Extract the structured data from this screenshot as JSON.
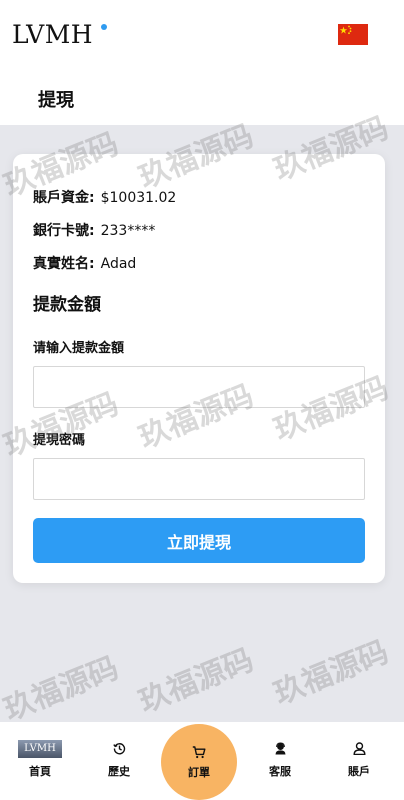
{
  "header": {
    "logo_text": "LVMH",
    "language_flag": "cn-flag"
  },
  "page": {
    "title": "提現"
  },
  "account": {
    "balance_label": "賬戶資金:",
    "balance_value": "$10031.02",
    "card_label": "銀行卡號:",
    "card_value": "233****",
    "name_label": "真實姓名:",
    "name_value": "Adad"
  },
  "withdraw": {
    "section_title": "提款金額",
    "amount_label": "请输入提款金額",
    "amount_value": "",
    "password_label": "提現密碼",
    "password_value": "",
    "submit_label": "立即提現"
  },
  "tabbar": {
    "items": [
      {
        "label": "首頁",
        "icon": "home-image"
      },
      {
        "label": "歷史",
        "icon": "history-icon"
      },
      {
        "label": "訂單",
        "icon": "cart-icon"
      },
      {
        "label": "客服",
        "icon": "support-icon"
      },
      {
        "label": "賬戶",
        "icon": "user-icon"
      }
    ],
    "home_image_text": "LVMH"
  },
  "watermark": "玖福源码",
  "colors": {
    "primary": "#2d9cf4",
    "orders_bubble": "#f8b463",
    "background": "#e6e7ec"
  }
}
